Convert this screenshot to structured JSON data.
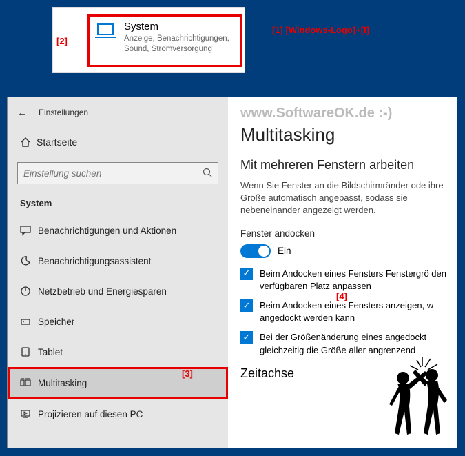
{
  "annotations": {
    "a1": "[1]  [Windows-Logo]+[I]",
    "a2": "[2]",
    "a3": "[3]",
    "a4": "[4]"
  },
  "systemCard": {
    "title": "System",
    "desc": "Anzeige, Benachrichtigungen, Sound, Stromversorgung"
  },
  "header": {
    "title": "Einstellungen"
  },
  "home": "Startseite",
  "search": {
    "placeholder": "Einstellung suchen"
  },
  "sectionLabel": "System",
  "nav": {
    "notifications": "Benachrichtigungen und Aktionen",
    "focus": "Benachrichtigungsassistent",
    "power": "Netzbetrieb und Energiesparen",
    "storage": "Speicher",
    "tablet": "Tablet",
    "multitasking": "Multitasking",
    "project": "Projizieren auf diesen PC"
  },
  "content": {
    "watermark": "www.SoftwareOK.de :-)",
    "pageTitle": "Multitasking",
    "sectionTitle": "Mit mehreren Fenstern arbeiten",
    "desc": "Wenn Sie Fenster an die Bildschirmränder ode ihre Größe automatisch angepasst, sodass sie nebeneinander angezeigt werden.",
    "dockLabel": "Fenster andocken",
    "toggleOn": "Ein",
    "check1": "Beim Andocken eines Fensters Fenstergrö den verfügbaren Platz anpassen",
    "check2": "Beim Andocken eines Fensters anzeigen, w angedockt werden kann",
    "check3": "Bei der Größenänderung eines angedockt gleichzeitig die Größe aller angrenzend",
    "timeline": "Zeitachse"
  }
}
